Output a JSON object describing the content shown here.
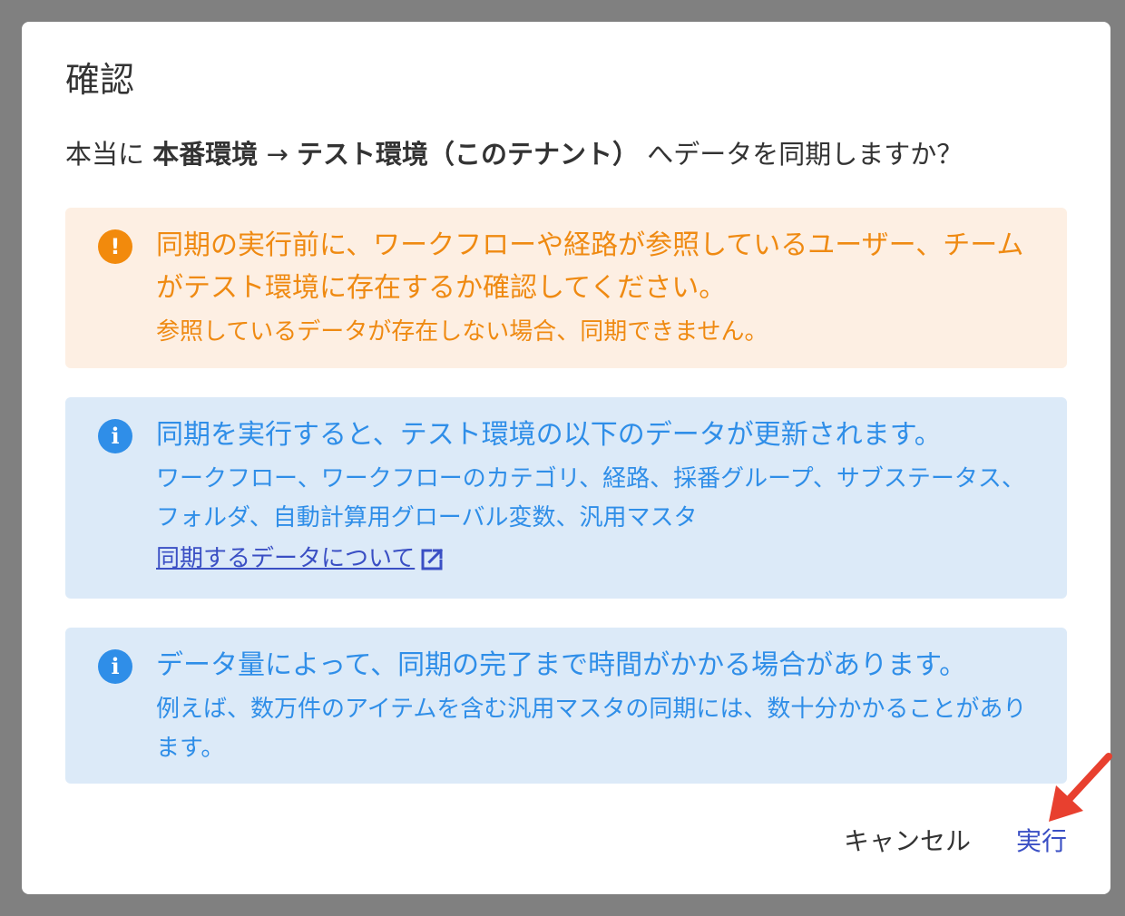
{
  "dialog": {
    "title": "確認",
    "question": {
      "prefix": "本当に ",
      "source": "本番環境",
      "arrow": " → ",
      "target": "テスト環境（このテナント）",
      "suffix": " へデータを同期しますか？"
    },
    "warning": {
      "icon": "exclamation-icon",
      "headline": "同期の実行前に、ワークフローや経路が参照しているユーザー、チームがテスト環境に存在するか確認してください。",
      "detail": "参照しているデータが存在しない場合、同期できません。"
    },
    "info_update": {
      "icon": "info-icon",
      "headline": "同期を実行すると、テスト環境の以下のデータが更新されます。",
      "detail": "ワークフロー、ワークフローのカテゴリ、経路、採番グループ、サブステータス、フォルダ、自動計算用グローバル変数、汎用マスタ",
      "link_label": "同期するデータについて",
      "link_icon": "external-link-icon"
    },
    "info_time": {
      "icon": "info-icon",
      "headline": "データ量によって、同期の完了まで時間がかかる場合があります。",
      "detail": "例えば、数万件のアイテムを含む汎用マスタの同期には、数十分かかることがあります。"
    },
    "buttons": {
      "cancel": "キャンセル",
      "execute": "実行"
    }
  },
  "colors": {
    "warning_text": "#ef8a12",
    "warning_bg": "#fdefe3",
    "info_text": "#2f8ee8",
    "info_bg": "#dceaf8",
    "link": "#3a4fc4",
    "annotation_arrow": "#e8402f"
  }
}
